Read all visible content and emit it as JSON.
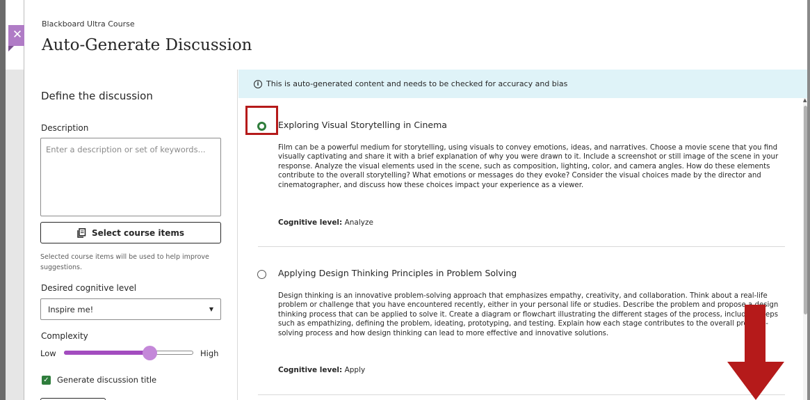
{
  "header": {
    "course_name": "Blackboard Ultra Course",
    "title": "Auto-Generate Discussion"
  },
  "left_panel": {
    "heading": "Define the discussion",
    "description_label": "Description",
    "description_placeholder": "Enter a description or set of keywords...",
    "select_items_label": "Select course items",
    "helper_text": "Selected course items will be used to help improve suggestions.",
    "cognitive_label": "Desired cognitive level",
    "cognitive_value": "Inspire me!",
    "complexity_label": "Complexity",
    "complexity_low": "Low",
    "complexity_high": "High",
    "complexity_level": 0.66,
    "generate_title_label": "Generate discussion title",
    "generate_title_checked": true
  },
  "right_panel": {
    "notice": "This is auto-generated content and needs to be checked for accuracy and bias",
    "level_prefix": "Cognitive level:",
    "suggestions": [
      {
        "title": "Exploring Visual Storytelling in Cinema",
        "body": "Film can be a powerful medium for storytelling, using visuals to convey emotions, ideas, and narratives. Choose a movie scene that you find visually captivating and share it with a brief explanation of why you were drawn to it. Include a screenshot or still image of the scene in your response. Analyze the visual elements used in the scene, such as composition, lighting, color, and camera angles. How do these elements contribute to the overall storytelling? What emotions or messages do they evoke? Consider the visual choices made by the director and cinematographer, and discuss how these choices impact your experience as a viewer.",
        "level": "Analyze",
        "selected": true
      },
      {
        "title": "Applying Design Thinking Principles in Problem Solving",
        "body": "Design thinking is an innovative problem-solving approach that emphasizes empathy, creativity, and collaboration. Think about a real-life problem or challenge that you have encountered recently, either in your personal life or studies. Describe the problem and propose a design thinking process that can be applied to solve it. Create a diagram or flowchart illustrating the different stages of the process, including steps such as empathizing, defining the problem, ideating, prototyping, and testing. Explain how each stage contributes to the overall problem-solving process and how design thinking can lead to more effective and innovative solutions.",
        "level": "Apply",
        "selected": false
      }
    ]
  },
  "colors": {
    "accent_purple": "#a34cbf",
    "selected_green": "#2f7d3c",
    "annotation_red": "#b51a1a",
    "notice_bg": "#dff3f8"
  },
  "icons": {
    "close": "close-icon",
    "select_items": "document-icon",
    "info": "info-icon",
    "dropdown": "caret-down-icon"
  }
}
